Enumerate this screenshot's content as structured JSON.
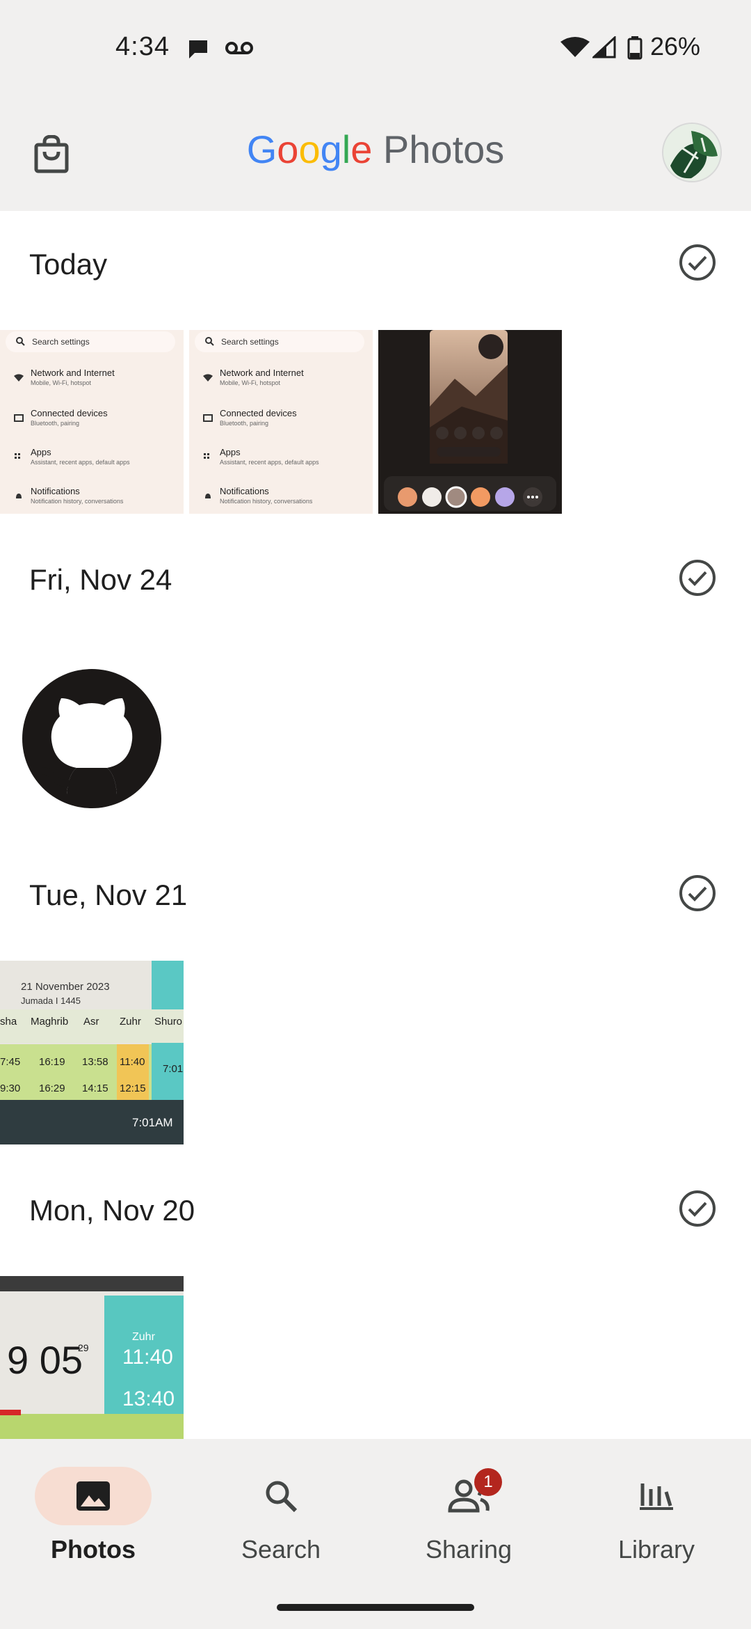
{
  "status_bar": {
    "time": "4:34",
    "battery": "26%"
  },
  "app_bar": {
    "title_google": [
      "G",
      "o",
      "o",
      "g",
      "l",
      "e"
    ],
    "title_product": "Photos"
  },
  "sections": [
    {
      "title": "Today"
    },
    {
      "title": "Fri, Nov 24"
    },
    {
      "title": "Tue, Nov 21"
    },
    {
      "title": "Mon, Nov 20"
    }
  ],
  "settings_screenshot": {
    "search_placeholder": "Search settings",
    "rows": [
      {
        "title": "Network and Internet",
        "subtitle": "Mobile, Wi-Fi, hotspot"
      },
      {
        "title": "Connected devices",
        "subtitle": "Bluetooth, pairing"
      },
      {
        "title": "Apps",
        "subtitle": "Assistant, recent apps, default apps"
      },
      {
        "title": "Notifications",
        "subtitle": "Notification history, conversations"
      }
    ]
  },
  "prayer_photo": {
    "date_line": "21 November 2023",
    "hijri_line": "Jumada I 1445",
    "columns": [
      "sha",
      "Maghrib",
      "Asr",
      "Zuhr",
      "Shuro"
    ],
    "row1": [
      "7:45",
      "16:19",
      "13:58",
      "11:40",
      "7:01"
    ],
    "row2": [
      "9:30",
      "16:29",
      "14:15",
      "12:15",
      ""
    ],
    "sunrise": "7:01AM"
  },
  "clock_photo": {
    "time": "9 05",
    "seconds": "29",
    "zuhr_label": "Zuhr",
    "zuhr_time": "11:40",
    "iqama_time": "13:40"
  },
  "bottom_nav": {
    "items": [
      {
        "label": "Photos"
      },
      {
        "label": "Search"
      },
      {
        "label": "Sharing",
        "badge": "1"
      },
      {
        "label": "Library"
      }
    ]
  },
  "colors": {
    "accent_pill": "#f7ddd2",
    "badge": "#b3261e",
    "bar_bg": "#f1f0ef"
  }
}
